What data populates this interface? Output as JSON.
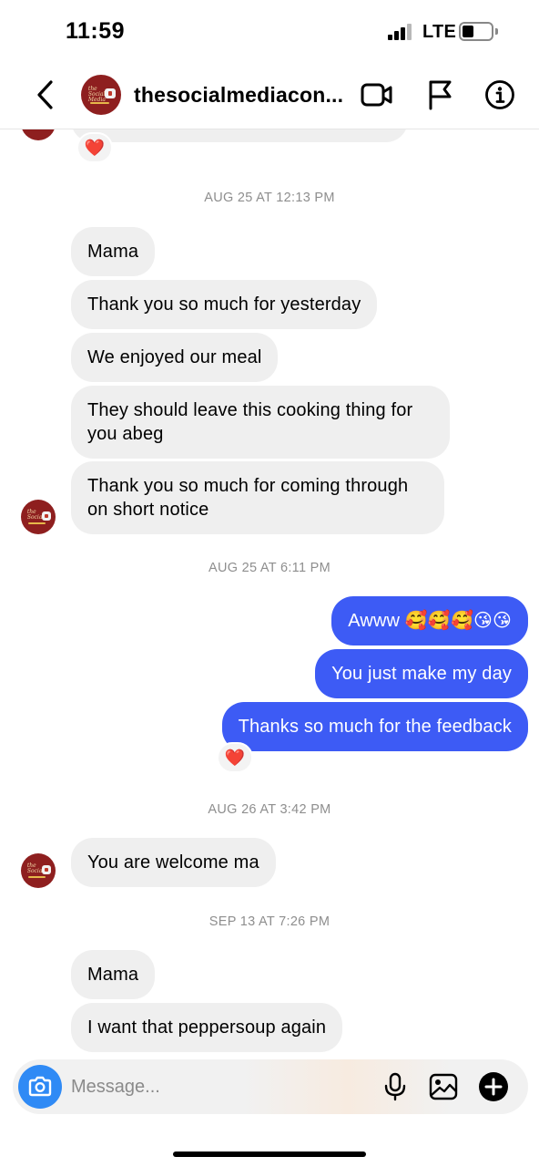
{
  "status_bar": {
    "time": "11:59",
    "network": "LTE"
  },
  "header": {
    "title": "thesocialmediacon..."
  },
  "timestamps": [
    "AUG 25 AT 12:13 PM",
    "AUG 25 AT 6:11 PM",
    "AUG 26 AT 3:42 PM",
    "SEP 13 AT 7:26 PM"
  ],
  "messages": [
    {
      "sender": "them",
      "text": "Mama"
    },
    {
      "sender": "them",
      "text": "Thank you so much for yesterday"
    },
    {
      "sender": "them",
      "text": "We enjoyed our meal"
    },
    {
      "sender": "them",
      "text": "They should leave this cooking thing for you abeg"
    },
    {
      "sender": "them",
      "text": "Thank you so much for coming through on short notice"
    },
    {
      "sender": "me",
      "text": "Awww 🥰🥰🥰😘😘"
    },
    {
      "sender": "me",
      "text": "You just make my day"
    },
    {
      "sender": "me",
      "text": "Thanks so much for the feedback"
    },
    {
      "sender": "them",
      "text": "You are welcome ma"
    },
    {
      "sender": "them",
      "text": "Mama"
    },
    {
      "sender": "them",
      "text": "I want that peppersoup again"
    }
  ],
  "reactions": [
    "❤️",
    "❤️"
  ],
  "composer": {
    "placeholder": "Message..."
  },
  "colors": {
    "outgoing_bubble": "#3d5bf5",
    "incoming_bubble": "#efefef",
    "camera_button": "#2f8af5",
    "avatar": "#8e1f1f"
  },
  "icons": [
    "chevron-left-icon",
    "video-camera-icon",
    "flag-icon",
    "info-icon",
    "camera-icon",
    "microphone-icon",
    "image-icon",
    "plus-circle-icon",
    "heart-icon"
  ]
}
